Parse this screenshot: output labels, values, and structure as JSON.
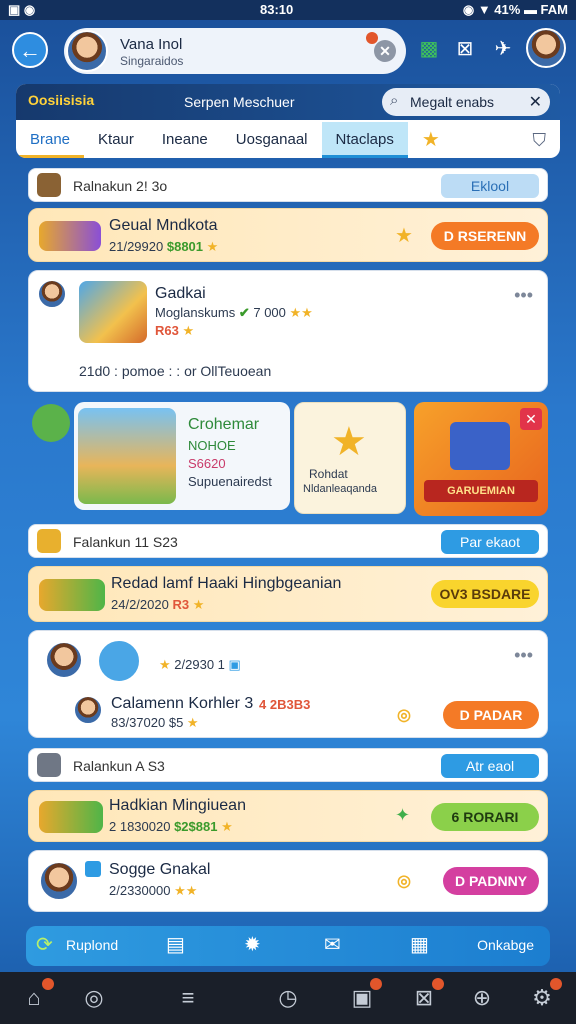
{
  "status_bar": {
    "time": "83:10",
    "right": "◉ ▼ 41% ▬ FAM"
  },
  "top_bar": {
    "user_name": "Vana Inol",
    "user_sub": "Singaraidos"
  },
  "panel": {
    "brand": "Oosiisisia",
    "subtitle": "Serpen Meschuer",
    "search_value": "Megalt enabs",
    "tabs": [
      "Brane",
      "Ktaur",
      "Ineane",
      "Uosganaal",
      "Ntaclaps"
    ]
  },
  "sections": [
    {
      "title": "Ralnakun 2! 3o",
      "button": "Eklool"
    },
    {
      "title": "Falankun 11 S23",
      "button": "Par ekaot"
    },
    {
      "title": "Ralankun A S3",
      "button": "Atr eaol"
    }
  ],
  "promo1": {
    "title": "Geual Mndkota",
    "meta": "21/29920",
    "price": "$8801",
    "button": "D RSERENN"
  },
  "post1": {
    "title": "Gadkai",
    "sub": "Moglanskums",
    "score": "7 000",
    "tags": "R63",
    "footer": "21d0 : pomoe : : or OllTeuoean"
  },
  "feature": {
    "title": "Crohemar",
    "sub1": "NOHOE",
    "sub2": "S6620",
    "sub3": "Supuenairedst",
    "star_card_line1": "Rohdat",
    "star_card_line2": "Nldanleaqanda",
    "banner": "GARUEMIAN"
  },
  "promo2": {
    "title": "Redad lamf Haaki Hingbgeanian",
    "meta": "24/2/2020",
    "tags": "R3",
    "button": "OV3 BSDARE"
  },
  "post2": {
    "meta": "2/2930 1",
    "title": "Calamenn Korhler 3",
    "score": "4 2B3B3",
    "sub": "83/37020 $5",
    "button": "D PADAR"
  },
  "promo3": {
    "title": "Hadkian Mingiuean",
    "meta": "2 1830020",
    "price": "$2$881",
    "button": "6 RORARI"
  },
  "post3": {
    "title": "Sogge Gnakal",
    "meta": "2/2330000",
    "button": "D PADNNY"
  },
  "bottom_strip": {
    "left_label": "Ruplond",
    "right_label": "Onkabge"
  },
  "colors": {
    "accent": "#2e9be3",
    "orange_button": "#f47a26",
    "yellow_button": "#f9d42d",
    "green_button": "#8bd04a",
    "pink_button": "#d43fa0"
  }
}
